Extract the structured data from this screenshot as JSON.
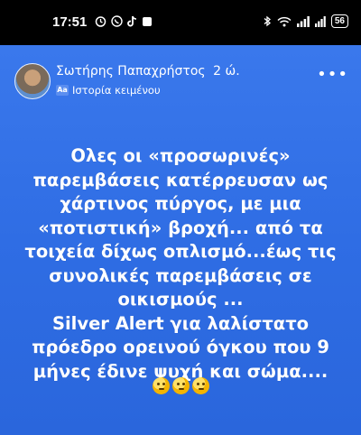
{
  "status_bar": {
    "time": "17:51",
    "battery": "56"
  },
  "story": {
    "author_name": "Σωτήρης Παπαχρήστος",
    "time_ago": "2 ώ.",
    "type_label": "Ιστορία κειμένου",
    "text_lines": [
      "Ολες οι «προσωρινές»",
      "παρεμβάσεις κατέρρευσαν ως",
      "χάρτινος πύργος, με μια",
      "«ποτιστική» βροχή...  από τα",
      "τοιχεία δίχως οπλισμό...έως τις",
      "συνολικές παρεμβάσεις σε",
      "οικισμούς ...",
      "Silver Alert για λαλίστατο",
      "πρόεδρο ορεινού όγκου που 9",
      "μήνες έδινε ψυχή και σώμα...."
    ],
    "emojis": [
      "thinking-face",
      "thinking-face",
      "thinking-face"
    ],
    "background_color": "#2f6fe4"
  }
}
